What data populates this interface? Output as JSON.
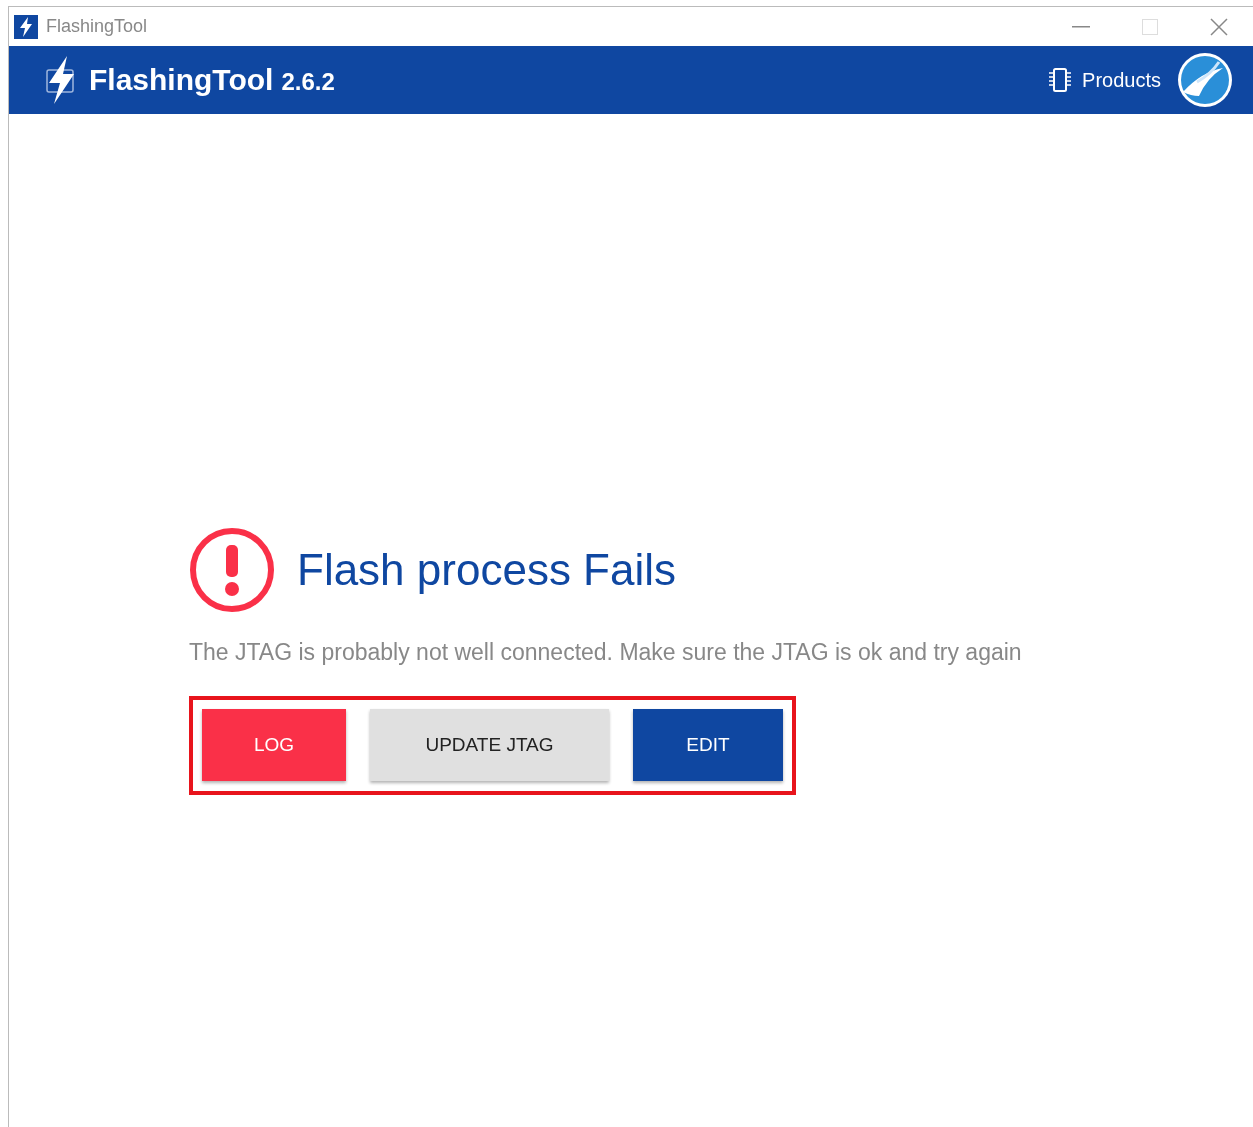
{
  "window": {
    "title": "FlashingTool"
  },
  "header": {
    "app_name": "FlashingTool",
    "version": "2.6.2",
    "nav_label": "Products"
  },
  "message": {
    "title": "Flash process Fails",
    "description": "The JTAG is probably not well connected. Make sure the JTAG is ok and try again"
  },
  "buttons": [
    {
      "label": "LOG",
      "kind": "danger"
    },
    {
      "label": "UPDATE JTAG",
      "kind": "neutral"
    },
    {
      "label": "EDIT",
      "kind": "primary"
    }
  ]
}
